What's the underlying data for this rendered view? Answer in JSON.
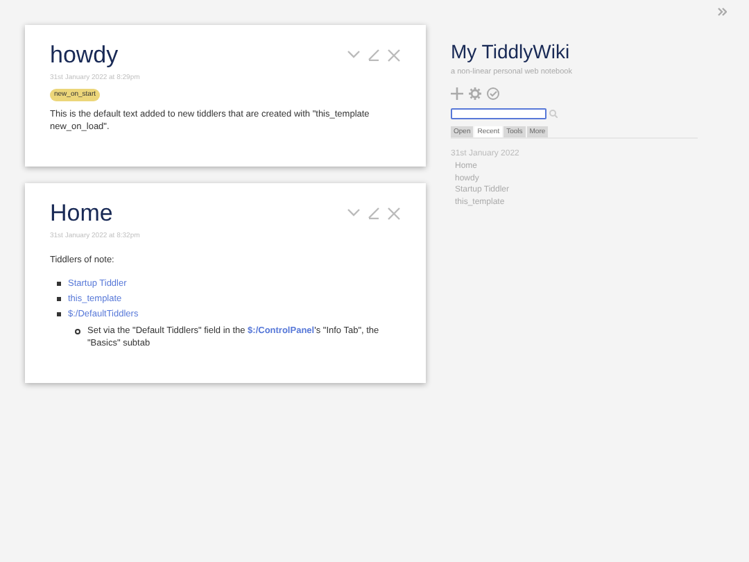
{
  "tiddlers": [
    {
      "title": "howdy",
      "date": "31st January 2022 at 8:29pm",
      "tags": [
        {
          "label": "new_on_start",
          "color": "#ecd67a"
        }
      ],
      "blocks": [
        {
          "kind": "paragraph",
          "segments": [
            {
              "kind": "text",
              "text": "This is the default text added to new tiddlers that are created with \"this_template new_on_load\"."
            }
          ]
        }
      ]
    },
    {
      "title": "Home",
      "date": "31st January 2022 at 8:32pm",
      "blocks": [
        {
          "kind": "paragraph",
          "segments": [
            {
              "kind": "text",
              "text": "Tiddlers of note:"
            }
          ]
        },
        {
          "kind": "list",
          "items": [
            {
              "segments": [
                {
                  "kind": "link",
                  "text": "Startup Tiddler"
                }
              ]
            },
            {
              "segments": [
                {
                  "kind": "link",
                  "text": "this_template"
                }
              ]
            },
            {
              "segments": [
                {
                  "kind": "link",
                  "text": "$:/DefaultTiddlers"
                }
              ],
              "children": [
                {
                  "segments": [
                    {
                      "kind": "text",
                      "text": "Set via the \"Default Tiddlers\" field in the "
                    },
                    {
                      "kind": "strong-link",
                      "text": "$:/ControlPanel"
                    },
                    {
                      "kind": "text",
                      "text": "'s \"Info Tab\", the \"Basics\" subtab"
                    }
                  ]
                }
              ]
            }
          ]
        }
      ]
    }
  ],
  "sidebar": {
    "title": "My TiddlyWiki",
    "subtitle": "a non-linear personal web notebook",
    "tabs": [
      {
        "label": "Open",
        "selected": false
      },
      {
        "label": "Recent",
        "selected": true
      },
      {
        "label": "Tools",
        "selected": false
      },
      {
        "label": "More",
        "selected": false
      }
    ],
    "recent": {
      "date": "31st January 2022",
      "items": [
        "Home",
        "howdy",
        "Startup Tiddler",
        "this_template"
      ]
    }
  }
}
